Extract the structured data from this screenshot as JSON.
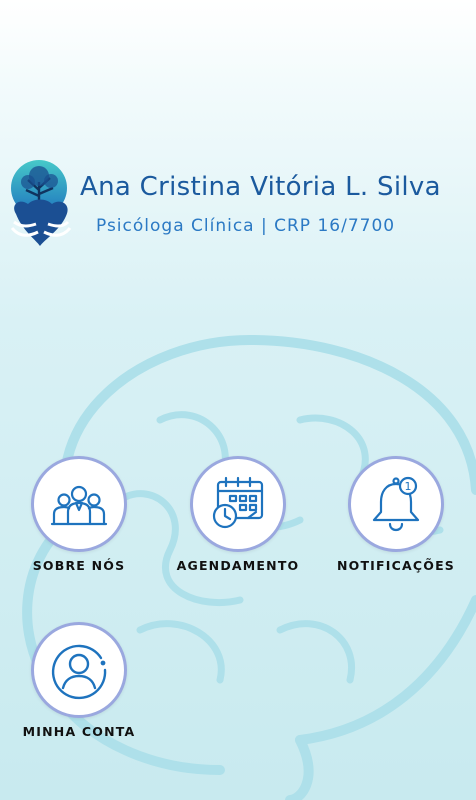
{
  "header": {
    "name": "Ana Cristina Vitória L. Silva",
    "subtitle": "Psicóloga Clínica | CRP 16/7700"
  },
  "menu": {
    "items": [
      {
        "label": "SOBRE NÓS",
        "icon": "team-icon"
      },
      {
        "label": "AGENDAMENTO",
        "icon": "calendar-clock-icon"
      },
      {
        "label": "NOTIFICAÇÕES",
        "icon": "bell-icon",
        "badge": "1"
      },
      {
        "label": "MINHA CONTA",
        "icon": "user-circle-icon"
      }
    ]
  },
  "colors": {
    "accent": "#1b5a9e",
    "icon": "#1e73be",
    "circle_border": "#9aa8df",
    "background": "#c8eaef"
  }
}
